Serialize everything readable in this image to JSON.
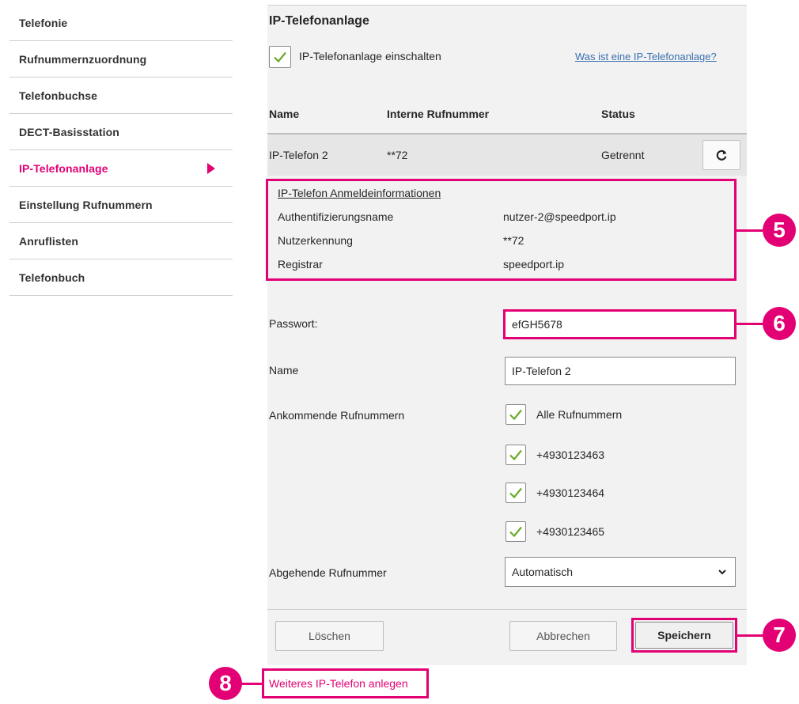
{
  "sidebar": {
    "items": [
      {
        "label": "Telefonie"
      },
      {
        "label": "Rufnummernzuordnung"
      },
      {
        "label": "Telefonbuchse"
      },
      {
        "label": "DECT-Basisstation"
      },
      {
        "label": "IP-Telefonanlage",
        "active": true
      },
      {
        "label": "Einstellung Rufnummern"
      },
      {
        "label": "Anruflisten"
      },
      {
        "label": "Telefonbuch"
      }
    ]
  },
  "main": {
    "title": "IP-Telefonanlage",
    "enable_checkbox": {
      "label": "IP-Telefonanlage einschalten",
      "checked": true
    },
    "help_link": "Was ist eine IP-Telefonanlage?",
    "table": {
      "headers": [
        "Name",
        "Interne Rufnummer",
        "Status"
      ],
      "row": {
        "name": "IP-Telefon 2",
        "number": "**72",
        "status": "Getrennt"
      }
    },
    "login_info": {
      "title": "IP-Telefon Anmeldeinformationen",
      "fields": [
        {
          "label": "Authentifizierungsname",
          "value": "nutzer-2@speedport.ip"
        },
        {
          "label": "Nutzerkennung",
          "value": "**72"
        },
        {
          "label": "Registrar",
          "value": "speedport.ip"
        }
      ]
    },
    "form": {
      "password_label": "Passwort:",
      "password_value": "efGH5678",
      "name_label": "Name",
      "name_value": "IP-Telefon 2",
      "incoming_label": "Ankommende Rufnummern",
      "incoming_options": [
        {
          "label": "Alle Rufnummern",
          "checked": true
        },
        {
          "label": "+4930123463",
          "checked": true
        },
        {
          "label": "+4930123464",
          "checked": true
        },
        {
          "label": "+4930123465",
          "checked": true
        }
      ],
      "outgoing_label": "Abgehende Rufnummer",
      "outgoing_value": "Automatisch"
    },
    "buttons": {
      "delete": "Löschen",
      "cancel": "Abbrechen",
      "save": "Speichern"
    },
    "add_link": "Weiteres IP-Telefon anlegen"
  },
  "markers": [
    "5",
    "6",
    "7",
    "8"
  ],
  "colors": {
    "accent": "#e20074",
    "check": "#6aaa2a",
    "link": "#3a6fb0",
    "panel": "#f2f2f2"
  },
  "icons": [
    "check-icon",
    "refresh-icon",
    "chevron-right-icon",
    "chevron-down-icon"
  ]
}
